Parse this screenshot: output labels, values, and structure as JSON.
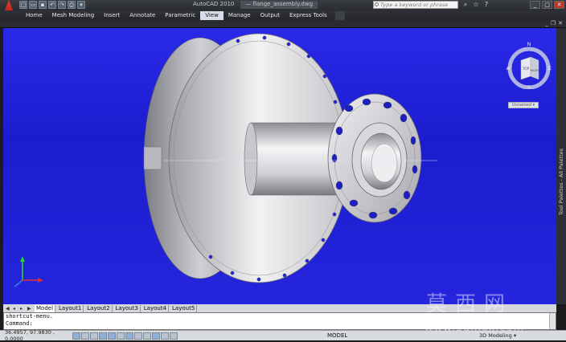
{
  "app": {
    "title_app": "AutoCAD 2010",
    "title_file": "— flange_assembly.dwg",
    "search_placeholder": "Type a keyword or phrase"
  },
  "qat_icons": [
    "new-icon",
    "open-icon",
    "save-icon",
    "undo-icon",
    "redo-icon",
    "print-icon",
    "dropdown-icon"
  ],
  "ribbon": {
    "tabs": [
      {
        "label": "Home"
      },
      {
        "label": "Mesh Modeling"
      },
      {
        "label": "Insert"
      },
      {
        "label": "Annotate"
      },
      {
        "label": "Parametric"
      },
      {
        "label": "View",
        "active": true
      },
      {
        "label": "Manage"
      },
      {
        "label": "Output"
      },
      {
        "label": "Express Tools"
      }
    ]
  },
  "viewport": {
    "background": "#2222e0",
    "viewcube_top_label": "TOP",
    "viewcube_right_label": "RIGHT",
    "compass_n": "N",
    "compass_s": "S",
    "compass_e": "E",
    "compass_w": "W",
    "ucs_x": "X",
    "ucs_y": "Y",
    "unsaved_label": "Unnamed ▾"
  },
  "right_palette_label": "Tool Palettes - All Palettes",
  "layout_tabs": [
    {
      "label": "Model",
      "active": true
    },
    {
      "label": "Layout1"
    },
    {
      "label": "Layout2"
    },
    {
      "label": "Layout3"
    },
    {
      "label": "Layout4"
    },
    {
      "label": "Layout5"
    }
  ],
  "command": {
    "line1": "shortcut-menu.",
    "line2": "Command:"
  },
  "status": {
    "coords": "36.4957, 97.9830 , 0.0000",
    "model": "MODEL",
    "workspace": "3D Modeling ▾"
  },
  "watermark": {
    "chars": "莫西网",
    "url": "www.3dmox.com"
  }
}
